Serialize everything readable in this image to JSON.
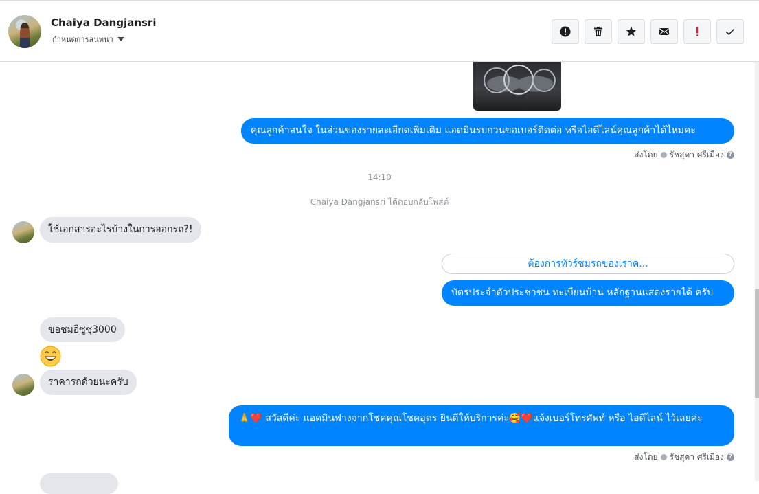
{
  "header": {
    "contact_name": "Chaiya Dangjansri",
    "subtitle": "กำหนดการสนทนา",
    "actions": [
      {
        "name": "report-button",
        "icon": "exclamation-circle-icon"
      },
      {
        "name": "delete-button",
        "icon": "trash-icon"
      },
      {
        "name": "star-button",
        "icon": "star-icon"
      },
      {
        "name": "mark-unread-button",
        "icon": "envelope-icon"
      },
      {
        "name": "priority-button",
        "icon": "exclamation-icon"
      },
      {
        "name": "done-button",
        "icon": "check-icon"
      }
    ]
  },
  "messages": {
    "out_1": "คุณลูกค้าสนใจ ในส่วนของรายละเอียดเพิ่มเติม แอดมินรบกวนขอเบอร์ติดต่อ หรือไอดีไลน์คุณลูกค้าได้ไหมคะ",
    "sent_by_1_prefix": "ส่งโดย",
    "sent_by_1_name": "รัชสุดา ศรีเมือง",
    "timestamp": "14:10",
    "reply_notice": "Chaiya Dangjansri ได้ตอบกลับโพสต์",
    "in_1": "ใช้เอกสารอะไรบ้างในการออกรถ?!",
    "quick_reply": "ต้องการทัวร์ชมรถของเราค...",
    "out_2": "บัตรประจำตัวประชาชน ทะเบียนบ้าน หลักฐานแสดงรายได้ ครับ",
    "in_2": "ขอชมอีซูซุ3000",
    "in_3": "ราคารถด้วยนะครับ",
    "out_3": "🙏❤️ สวัสดีค่ะ แอดมินฟางจากโชคคุณโชคอุดร ยินดีให้บริการค่ะ🥰❤️แจ้งเบอร์โทรศัพท์ หรือ ไอดีไลน์  ไว้เลยค่ะ",
    "sent_by_2_prefix": "ส่งโดย",
    "sent_by_2_name": "รัชสุดา ศรีเมือง"
  },
  "colors": {
    "outgoing": "#0084ff",
    "incoming": "#e4e6eb",
    "priority": "#e41e3f"
  }
}
